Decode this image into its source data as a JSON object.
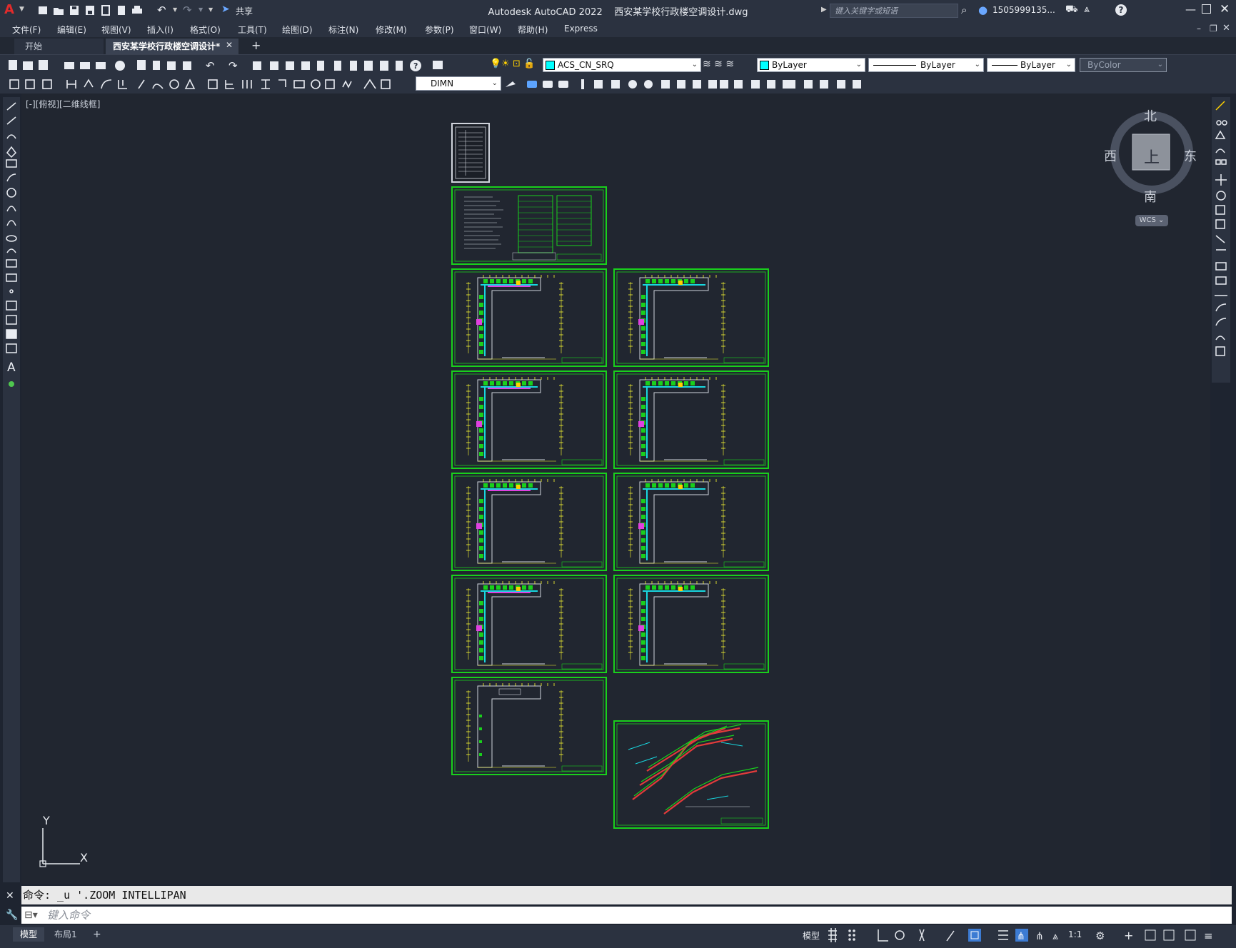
{
  "titlebar": {
    "app": "Autodesk AutoCAD 2022",
    "file": "西安某学校行政楼空调设计.dwg",
    "share_label": "共享",
    "search_placeholder": "键入关键字或短语",
    "user": "1505999135...",
    "help": "?"
  },
  "menu": [
    "文件(F)",
    "编辑(E)",
    "视图(V)",
    "插入(I)",
    "格式(O)",
    "工具(T)",
    "绘图(D)",
    "标注(N)",
    "修改(M)",
    "参数(P)",
    "窗口(W)",
    "帮助(H)",
    "Express"
  ],
  "tabs": {
    "start": "开始",
    "active": "西安某学校行政楼空调设计*",
    "add": "+"
  },
  "toolbar": {
    "layer": "ACS_CN_SRQ",
    "color": "ByLayer",
    "linetype": "ByLayer",
    "lineweight": "ByLayer",
    "plotstyle": "ByColor",
    "dimstyle": "DIMN",
    "layer_color": "#00ffff"
  },
  "viewport": {
    "label": "[-][俯视][二维线框]",
    "compass": {
      "north": "北",
      "south": "南",
      "east": "东",
      "west": "西",
      "top": "上"
    },
    "wcs": "WCS",
    "ucs_x": "X",
    "ucs_y": "Y"
  },
  "command": {
    "history": "命令: _u '.ZOOM INTELLIPAN",
    "placeholder": "键入命令"
  },
  "layouts": [
    "模型",
    "布局1",
    "+"
  ],
  "status": {
    "model": "模型",
    "scale": "1:1"
  }
}
